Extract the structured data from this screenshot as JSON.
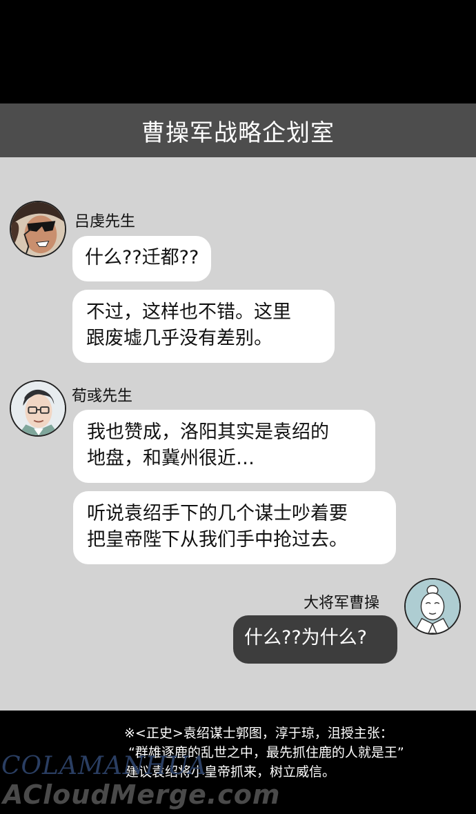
{
  "header": {
    "title": "曹操军战略企划室"
  },
  "messages": {
    "lu": {
      "name": "吕虔先生",
      "avatar_icon": "man-with-sunglasses-avatar-icon",
      "bubble1": "什么??迁都??",
      "bubble2_line1": "不过，这样也不错。这里",
      "bubble2_line2": "跟废墟几乎没有差别。"
    },
    "xun": {
      "name": "荀彧先生",
      "avatar_icon": "man-with-glasses-avatar-icon",
      "bubble1_line1": "我也赞成，洛阳其实是袁绍的",
      "bubble1_line2": "地盘，和冀州很近…",
      "bubble2_line1": "听说袁绍手下的几个谋士吵着要",
      "bubble2_line2": "把皇帝陛下从我们手中抢过去。"
    },
    "cao": {
      "name": "大将军曹操",
      "avatar_icon": "man-in-robe-avatar-icon",
      "bubble1": "什么??为什么?"
    }
  },
  "footnote": {
    "line1": "※<正史>袁绍谋士郭图，淳于琼，沮授主张：",
    "line2": "“群雄逐鹿的乱世之中，最先抓住鹿的人就是王”",
    "line3": "建议袁绍将小皇帝抓来，树立威信。"
  },
  "watermark": {
    "line1": "COLAMANHUA",
    "line2": "ACloudMerge.com"
  },
  "colors": {
    "header_bg": "#4d4d4d",
    "chat_bg": "#d3d3d3",
    "self_bubble": "#3d3d3d"
  }
}
